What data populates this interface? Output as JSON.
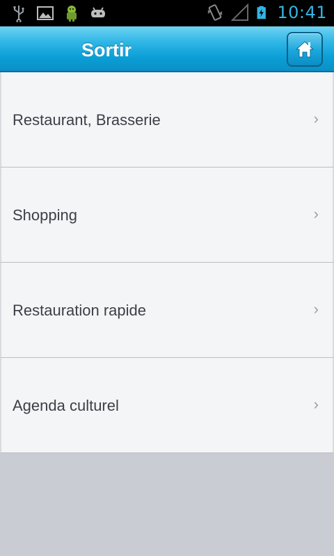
{
  "status_bar": {
    "time": "10:41",
    "left_icons": [
      "usb-icon",
      "image-icon",
      "android-icon",
      "gamepad-icon"
    ],
    "right_icons": [
      "vibrate-icon",
      "signal-icon",
      "battery-charging-icon"
    ],
    "accent_color": "#33b5e5"
  },
  "header": {
    "title": "Sortir",
    "home_icon": "home-icon"
  },
  "list": {
    "items": [
      {
        "label": "Restaurant, Brasserie",
        "chevron": "›"
      },
      {
        "label": "Shopping",
        "chevron": "›"
      },
      {
        "label": "Restauration rapide",
        "chevron": "›"
      },
      {
        "label": "Agenda culturel",
        "chevron": "›"
      }
    ]
  }
}
